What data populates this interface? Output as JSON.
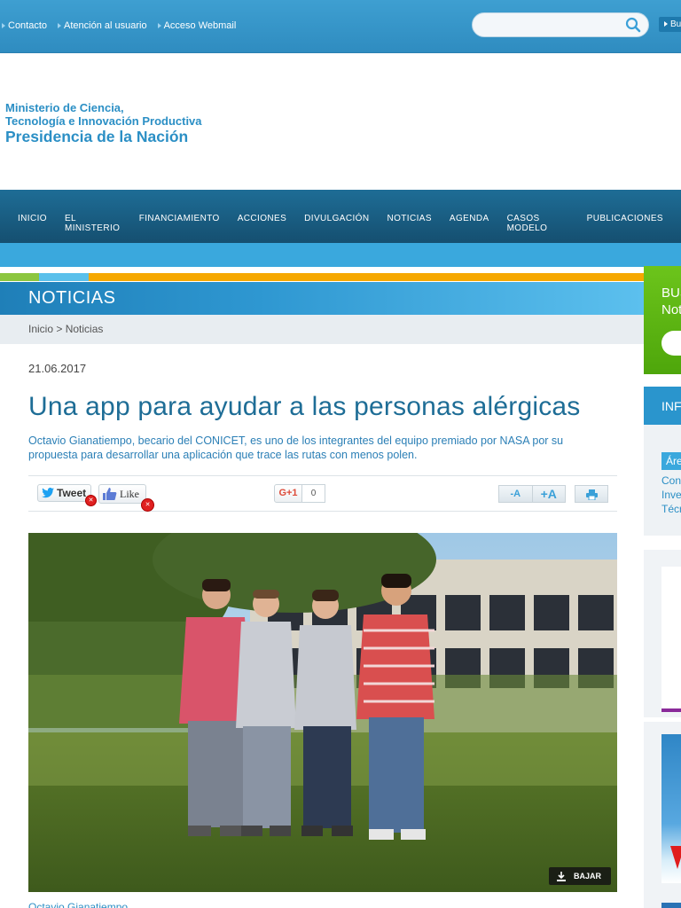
{
  "topbar": {
    "links": [
      "Contacto",
      "Atención al usuario",
      "Acceso Webmail"
    ],
    "search": {
      "placeholder": "",
      "button_label": "Bu"
    }
  },
  "logo": {
    "line1": "Ministerio de Ciencia,",
    "line2": "Tecnología e Innovación Productiva",
    "line3": "Presidencia de la Nación"
  },
  "nav": {
    "items": [
      "INICIO",
      "EL MINISTERIO",
      "FINANCIAMIENTO",
      "ACCIONES",
      "DIVULGACIÓN",
      "NOTICIAS",
      "AGENDA",
      "CASOS MODELO",
      "PUBLICACIONES"
    ]
  },
  "stripes": [
    "#8cc63f",
    "#5bc0eb",
    "#f6a800"
  ],
  "section": {
    "title": "NOTICIAS",
    "breadcrumb": "Inicio > Noticias"
  },
  "article": {
    "date": "21.06.2017",
    "title": "Una app para ayudar a las personas alérgicas",
    "lead": "Octavio Gianatiempo, becario del CONICET, es uno de los integrantes del equipo premiado por NASA por su propuesta para desarrollar una aplicación que trace las rutas con menos polen.",
    "share": {
      "tweet_label": "Tweet",
      "like_label": "Like",
      "gplus_label": "G+1",
      "gplus_count": "0",
      "font_smaller": "-A",
      "font_bigger": "+A"
    },
    "photo": {
      "download_label": "BAJAR"
    },
    "caption": "Octavio Gianatiempo..."
  },
  "sidebar": {
    "search_title": "BUS",
    "search_subtitle": "Not",
    "info_header": "INF",
    "area_label": "Áre",
    "links": [
      "Con",
      "Inve",
      "Técr"
    ]
  },
  "colors": {
    "brand_blue": "#2b8fc5",
    "nav_dark": "#1e6d96",
    "green": "#6cc41b"
  }
}
